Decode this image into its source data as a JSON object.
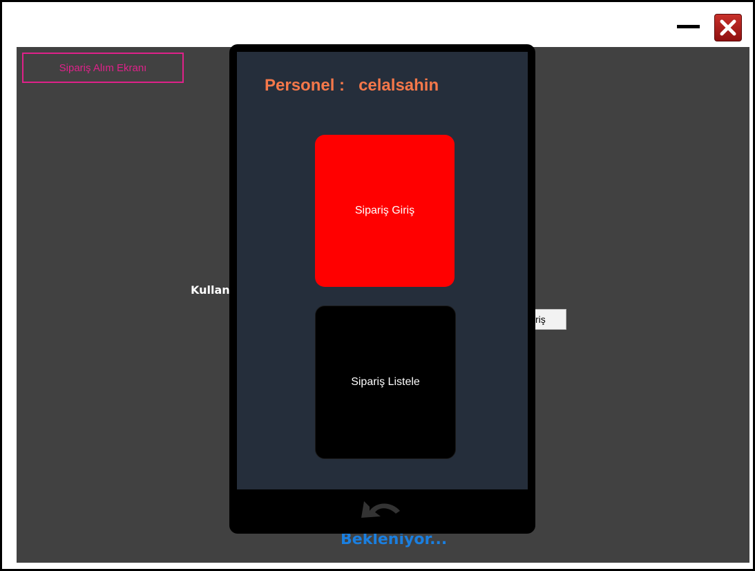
{
  "window": {
    "minimize_icon": "minimize-icon",
    "close_icon": "close-icon",
    "close_color": "#c8302a"
  },
  "background": {
    "title": "Sipariş Alım Ekranı",
    "label_partial": "Kullan",
    "button_partial": "riş",
    "status_partial": "Bekleniyor..."
  },
  "panel": {
    "personel_label": "Personel :",
    "username": "celalsahin",
    "tile_order_entry": "Sipariş Giriş",
    "tile_order_list": "Sipariş Listele",
    "back_icon": "back-arrow-icon"
  },
  "colors": {
    "accent_pink": "#e0218a",
    "accent_orange": "#f5784a",
    "tile_red": "#ff0000",
    "status_blue": "#1a7fe0"
  }
}
